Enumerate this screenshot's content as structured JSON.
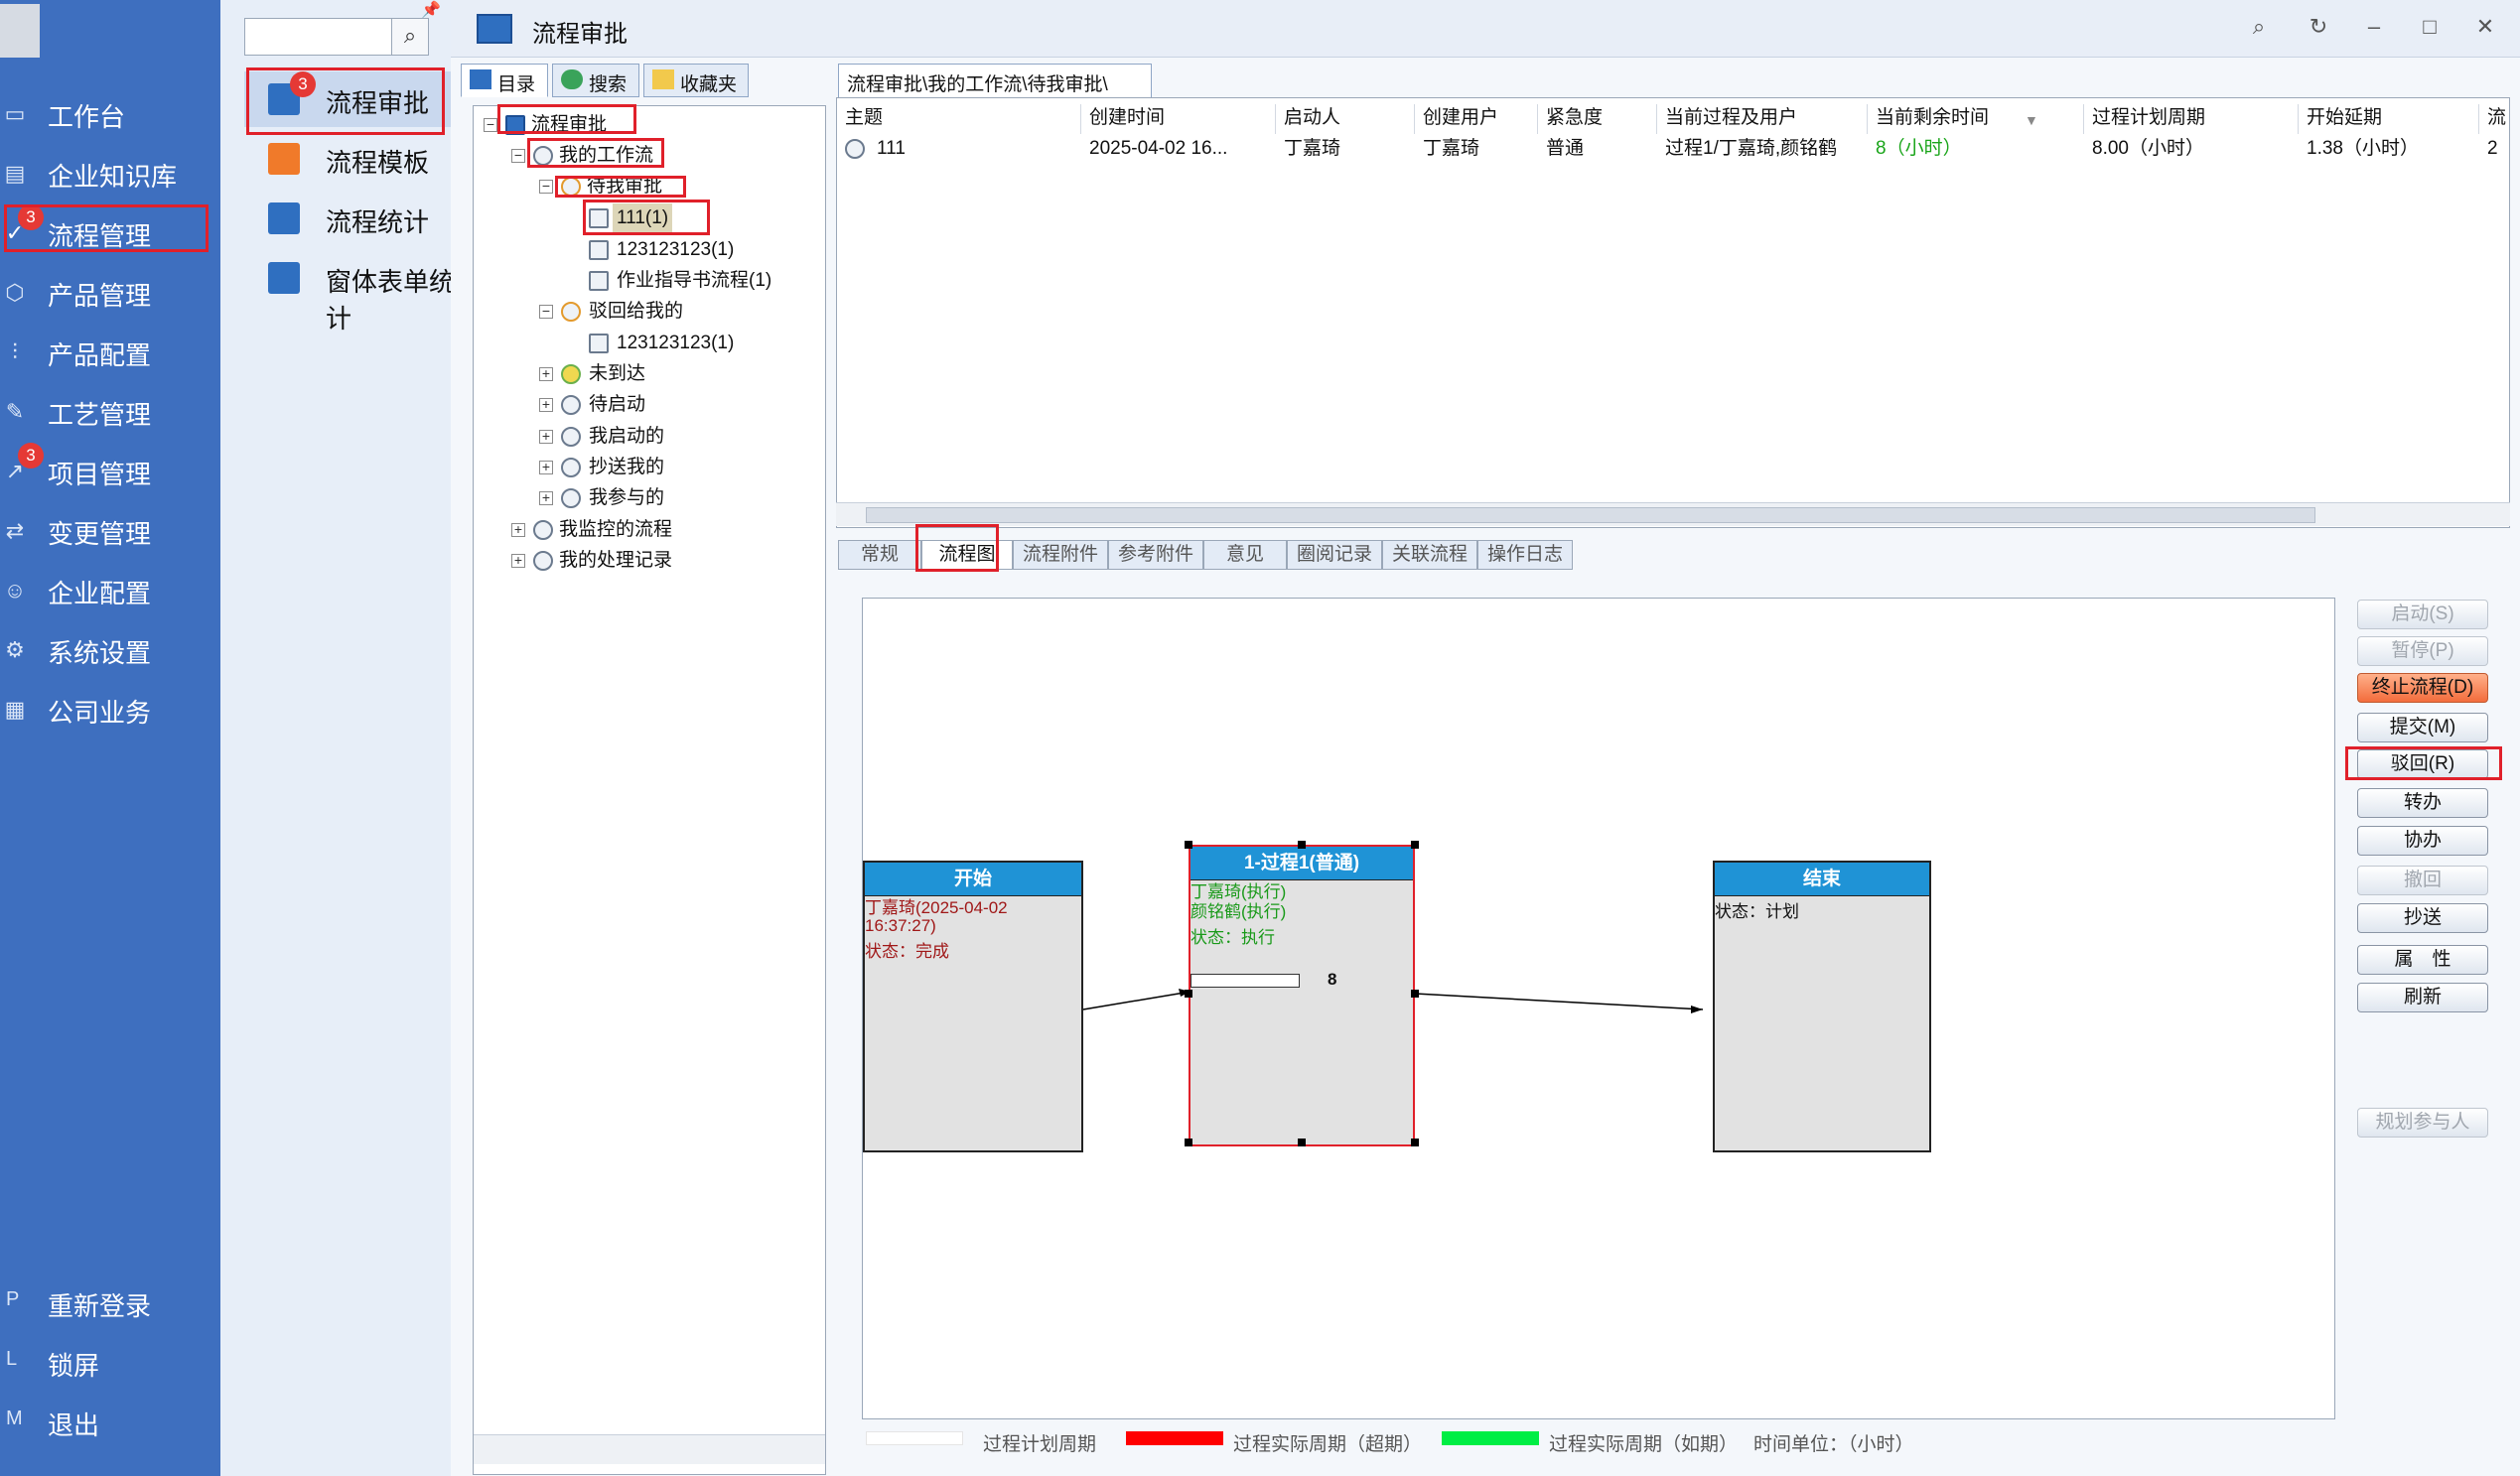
{
  "nav": {
    "items": [
      {
        "label": "工作台",
        "icon": "monitor-icon"
      },
      {
        "label": "企业知识库",
        "icon": "book-icon"
      },
      {
        "label": "流程管理",
        "icon": "check-icon",
        "badge": "3"
      },
      {
        "label": "产品管理",
        "icon": "cube-icon"
      },
      {
        "label": "产品配置",
        "icon": "sliders-icon"
      },
      {
        "label": "工艺管理",
        "icon": "wrench-icon"
      },
      {
        "label": "项目管理",
        "icon": "chart-icon",
        "badge": "3"
      },
      {
        "label": "变更管理",
        "icon": "swap-icon"
      },
      {
        "label": "企业配置",
        "icon": "users-icon"
      },
      {
        "label": "系统设置",
        "icon": "gear-icon"
      },
      {
        "label": "公司业务",
        "icon": "grid-icon"
      }
    ],
    "bottom": [
      {
        "key": "P",
        "label": "重新登录"
      },
      {
        "key": "L",
        "label": "锁屏"
      },
      {
        "key": "M",
        "label": "退出"
      }
    ]
  },
  "subnav": {
    "items": [
      {
        "label": "流程审批",
        "badge": "3",
        "color": "#2f6fc0"
      },
      {
        "label": "流程模板",
        "color": "#f07a2a"
      },
      {
        "label": "流程统计",
        "color": "#2f6fc0"
      },
      {
        "label": "窗体表单统计",
        "color": "#2f6fc0"
      }
    ]
  },
  "window": {
    "title": "流程审批"
  },
  "tree_tabs": [
    "目录",
    "搜索",
    "收藏夹"
  ],
  "tree": {
    "root": "流程审批",
    "my_workflow": "我的工作流",
    "pending": "待我审批",
    "pending_children": [
      "111(1)",
      "123123123(1)",
      "作业指导书流程(1)"
    ],
    "rejected": "驳回给我的",
    "rejected_children": [
      "123123123(1)"
    ],
    "others": [
      "未到达",
      "待启动",
      "我启动的",
      "抄送我的",
      "我参与的"
    ],
    "monitored": "我监控的流程",
    "records": "我的处理记录"
  },
  "breadcrumb": "流程审批\\我的工作流\\待我审批\\",
  "table": {
    "columns": [
      "主题",
      "创建时间",
      "启动人",
      "创建用户",
      "紧急度",
      "当前过程及用户",
      "当前剩余时间",
      "过程计划周期",
      "开始延期",
      "流"
    ],
    "rows": [
      [
        "111",
        "2025-04-02 16...",
        "丁嘉琦",
        "丁嘉琦",
        "普通",
        "过程1/丁嘉琦,颜铭鹤",
        "8（小时）",
        "8.00（小时）",
        "1.38（小时）",
        "2"
      ]
    ]
  },
  "detail_tabs": [
    "常规",
    "流程图",
    "流程附件",
    "参考附件",
    "意见",
    "圈阅记录",
    "关联流程",
    "操作日志"
  ],
  "diagram": {
    "start": {
      "title": "开始",
      "user": "丁嘉琦(2025-04-02",
      "time": "16:37:27)",
      "status": "状态：完成"
    },
    "process": {
      "title": "1-过程1(普通)",
      "user1": "丁嘉琦(执行)",
      "user2": "颜铭鹤(执行)",
      "status": "状态：执行",
      "value": "8"
    },
    "end": {
      "title": "结束",
      "status": "状态：计划"
    }
  },
  "actions": [
    "启动(S)",
    "暂停(P)",
    "终止流程(D)",
    "提交(M)",
    "驳回(R)",
    "转办",
    "协办",
    "撤回",
    "抄送",
    "属　性",
    "刷新",
    "规划参与人"
  ],
  "legend": {
    "plan": "过程计划周期",
    "overdue": "过程实际周期（超期）",
    "ontime": "过程实际周期（如期）",
    "unit": "时间单位：（小时）"
  },
  "colors": {
    "nav_bg": "#3e6fbf",
    "node_header": "#1f93d6",
    "overdue": "#ff0000",
    "ontime": "#00ee44",
    "highlight": "#e0202a"
  }
}
